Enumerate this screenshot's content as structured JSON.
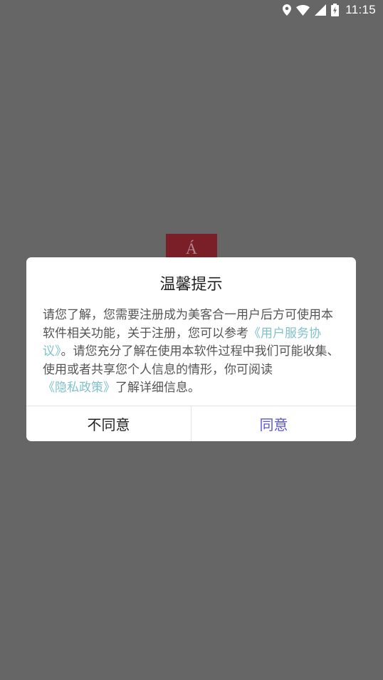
{
  "status_bar": {
    "time": "11:15",
    "icons": [
      "location-icon",
      "wifi-icon",
      "signal-icon",
      "battery-charging-icon"
    ]
  },
  "splash": {
    "logo_glyph": "Á",
    "logo_color": "#7a1f27"
  },
  "dialog": {
    "title": "温馨提示",
    "body_text_1": "请您了解，您需要注册成为美客合一用户后方可使用本软件相关功能，关于注册，您可以参考",
    "user_agreement_link": "《用户服务协议》",
    "body_text_2": "。请您充分了解在使用本软件过程中我们可能收集、使用或者共享您个人信息的情形，你可阅读",
    "privacy_policy_link": "《隐私政策》",
    "body_text_3": "了解详细信息。",
    "disagree_label": "不同意",
    "agree_label": "同意",
    "link_color": "#7fc2c8",
    "agree_color": "#5b55d6"
  }
}
